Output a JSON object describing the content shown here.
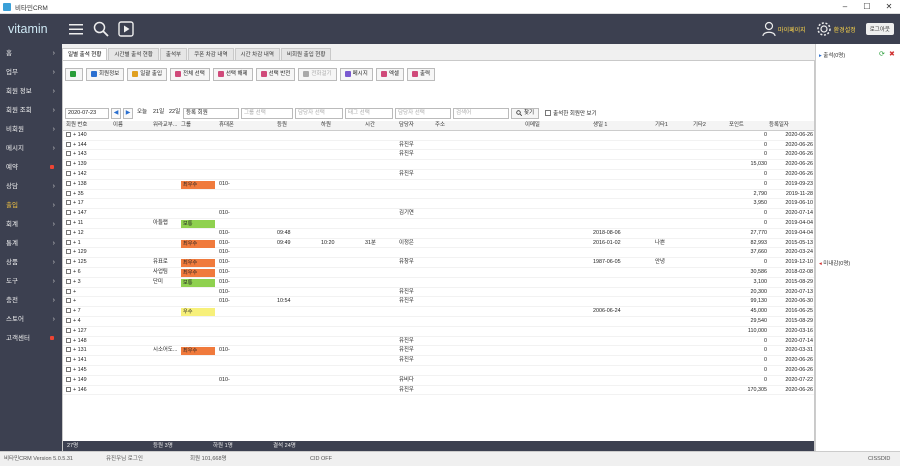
{
  "window": {
    "title": "비타민CRM",
    "min": "–",
    "max": "☐",
    "close": "✕"
  },
  "brand": "vitamin",
  "topbar": {
    "mypage": "마이페이지",
    "settings": "환경설정",
    "logout": "로그아웃"
  },
  "sidebar": [
    {
      "label": "홈",
      "suffix": "chevron"
    },
    {
      "label": "업무",
      "suffix": "chevron"
    },
    {
      "label": "회원 정보",
      "suffix": "chevron"
    },
    {
      "label": "회원 조회",
      "suffix": "chevron"
    },
    {
      "label": "비회원",
      "suffix": "chevron"
    },
    {
      "label": "메시지",
      "suffix": "chevron"
    },
    {
      "label": "예약",
      "suffix": "dot"
    },
    {
      "label": "상담",
      "suffix": "chevron"
    },
    {
      "label": "출입",
      "suffix": "chevron",
      "active": true
    },
    {
      "label": "회계",
      "suffix": "chevron"
    },
    {
      "label": "통계",
      "suffix": "chevron"
    },
    {
      "label": "상품",
      "suffix": "chevron"
    },
    {
      "label": "도구",
      "suffix": "chevron"
    },
    {
      "label": "충전",
      "suffix": "chevron"
    },
    {
      "label": "스토어",
      "suffix": "chevron"
    },
    {
      "label": "고객센터",
      "suffix": "dot"
    }
  ],
  "tabs": [
    "일별 출석 현황",
    "시간별 출석 현황",
    "출석부",
    "쿠폰 차감 내역",
    "시간 차감 내역",
    "비회원 출입 현황"
  ],
  "toolbar": [
    {
      "label": "",
      "icon": "refresh-icon",
      "color": "#2a9d3a"
    },
    {
      "label": "회원정보",
      "icon": "member-info-icon",
      "color": "#2a6fd0"
    },
    {
      "label": "일괄 출입",
      "icon": "bulk-entry-icon",
      "color": "#e0a020"
    },
    {
      "label": "전체 선택",
      "icon": "select-all-icon",
      "color": "#d04a7a"
    },
    {
      "label": "선택 해제",
      "icon": "deselect-icon",
      "color": "#d04a7a"
    },
    {
      "label": "선택 반전",
      "icon": "invert-select-icon",
      "color": "#d04a7a"
    },
    {
      "label": "전화걸기",
      "icon": "phone-icon",
      "color": "#aaa",
      "disabled": true
    },
    {
      "label": "메시지",
      "icon": "message-icon",
      "color": "#7a5ad0"
    },
    {
      "label": "엑셀",
      "icon": "excel-icon",
      "color": "#d04a7a"
    },
    {
      "label": "출력",
      "icon": "print-icon",
      "color": "#d04a7a"
    }
  ],
  "filters": {
    "date": "2020-07-23",
    "dayname": "오늘",
    "days": [
      "21일",
      "22일"
    ],
    "member_type": "등록 회원",
    "ph1": "그룹 선택",
    "ph2": "담당자 선택",
    "ph3": "태그 선택",
    "ph4": "담당자 선택",
    "ph5": "검색어",
    "search_label": "찾기",
    "checkbox_label": "출석한 회원만 보기"
  },
  "columns": [
    "회원 번호",
    "이름",
    "워라교부...",
    "그룹",
    "휴대폰",
    "등원",
    "하원",
    "시간",
    "담당자",
    "주소",
    "이메일",
    "생일 1",
    "기타1",
    "기타2",
    "포인트",
    "등록일자"
  ],
  "rows": [
    {
      "no": "140",
      "name": "",
      "work": "",
      "group": "",
      "phone": "",
      "in": "",
      "out": "",
      "time": "",
      "mgr": "",
      "addr": "",
      "email": "",
      "bday": "",
      "e1": "",
      "e2": "",
      "point": "0",
      "reg": "2020-06-26"
    },
    {
      "no": "144",
      "name": "",
      "work": "",
      "group": "",
      "phone": "",
      "in": "",
      "out": "",
      "time": "",
      "mgr": "유진우",
      "addr": "",
      "email": "",
      "bday": "",
      "e1": "",
      "e2": "",
      "point": "0",
      "reg": "2020-06-26"
    },
    {
      "no": "143",
      "name": "",
      "work": "",
      "group": "",
      "phone": "",
      "in": "",
      "out": "",
      "time": "",
      "mgr": "유진우",
      "addr": "",
      "email": "",
      "bday": "",
      "e1": "",
      "e2": "",
      "point": "0",
      "reg": "2020-06-26"
    },
    {
      "no": "139",
      "name": "",
      "work": "",
      "group": "",
      "phone": "",
      "in": "",
      "out": "",
      "time": "",
      "mgr": "",
      "addr": "",
      "email": "",
      "bday": "",
      "e1": "",
      "e2": "",
      "point": "15,030",
      "reg": "2020-06-26"
    },
    {
      "no": "142",
      "name": "",
      "work": "",
      "group": "",
      "phone": "",
      "in": "",
      "out": "",
      "time": "",
      "mgr": "유진우",
      "addr": "",
      "email": "",
      "bday": "",
      "e1": "",
      "e2": "",
      "point": "0",
      "reg": "2020-06-26"
    },
    {
      "no": "138",
      "name": "",
      "work": "",
      "group": "최우수",
      "phone": "010-",
      "in": "",
      "out": "",
      "time": "",
      "mgr": "",
      "addr": "",
      "email": "",
      "bday": "",
      "e1": "",
      "e2": "",
      "point": "0",
      "reg": "2019-09-23"
    },
    {
      "no": "35",
      "name": "",
      "work": "",
      "group": "",
      "phone": "",
      "in": "",
      "out": "",
      "time": "",
      "mgr": "",
      "addr": "",
      "email": "",
      "bday": "",
      "e1": "",
      "e2": "",
      "point": "2,790",
      "reg": "2019-11-28"
    },
    {
      "no": "17",
      "name": "",
      "work": "",
      "group": "",
      "phone": "",
      "in": "",
      "out": "",
      "time": "",
      "mgr": "",
      "addr": "",
      "email": "",
      "bday": "",
      "e1": "",
      "e2": "",
      "point": "3,950",
      "reg": "2019-06-10"
    },
    {
      "no": "147",
      "name": "",
      "work": "",
      "group": "",
      "phone": "010-",
      "in": "",
      "out": "",
      "time": "",
      "mgr": "김기연",
      "addr": "",
      "email": "",
      "bday": "",
      "e1": "",
      "e2": "",
      "point": "0",
      "reg": "2020-07-14"
    },
    {
      "no": "11",
      "name": "",
      "work": "아들랩",
      "group": "보통",
      "phone": "",
      "in": "",
      "out": "",
      "time": "",
      "mgr": "",
      "addr": "",
      "email": "",
      "bday": "",
      "e1": "",
      "e2": "",
      "point": "0",
      "reg": "2019-04-04"
    },
    {
      "no": "12",
      "name": "",
      "work": "",
      "group": "",
      "phone": "010-",
      "in": "09:48",
      "out": "",
      "time": "",
      "mgr": "",
      "addr": "",
      "email": "",
      "bday": "2018-08-06",
      "e1": "",
      "e2": "",
      "point": "27,770",
      "reg": "2019-04-04"
    },
    {
      "no": "1",
      "name": "",
      "work": "",
      "group": "최우수",
      "phone": "010-",
      "in": "09:49",
      "out": "10:20",
      "time": "31분",
      "mgr": "이정은",
      "addr": "",
      "email": "",
      "bday": "2016-01-02",
      "e1": "나쁜",
      "e2": "",
      "point": "82,993",
      "reg": "2015-05-13"
    },
    {
      "no": "129",
      "name": "",
      "work": "",
      "group": "",
      "phone": "010-",
      "in": "",
      "out": "",
      "time": "",
      "mgr": "",
      "addr": "",
      "email": "",
      "bday": "",
      "e1": "",
      "e2": "",
      "point": "37,660",
      "reg": "2020-03-24"
    },
    {
      "no": "125",
      "name": "",
      "work": "유표로",
      "group": "최우수",
      "phone": "010-",
      "in": "",
      "out": "",
      "time": "",
      "mgr": "유창우",
      "addr": "",
      "email": "",
      "bday": "1987-06-05",
      "e1": "안녕",
      "e2": "",
      "point": "0",
      "reg": "2019-12-10"
    },
    {
      "no": "6",
      "name": "",
      "work": "사업팀",
      "group": "최우수",
      "phone": "010-",
      "in": "",
      "out": "",
      "time": "",
      "mgr": "",
      "addr": "",
      "email": "",
      "bday": "",
      "e1": "",
      "e2": "",
      "point": "30,586",
      "reg": "2018-02-08"
    },
    {
      "no": "3",
      "name": "",
      "work": "단미",
      "group": "보통",
      "phone": "010-",
      "in": "",
      "out": "",
      "time": "",
      "mgr": "",
      "addr": "",
      "email": "",
      "bday": "",
      "e1": "",
      "e2": "",
      "point": "3,100",
      "reg": "2015-08-29"
    },
    {
      "no": "",
      "name": "",
      "work": "",
      "group": "",
      "phone": "010-",
      "in": "",
      "out": "",
      "time": "",
      "mgr": "유진우",
      "addr": "",
      "email": "",
      "bday": "",
      "e1": "",
      "e2": "",
      "point": "20,300",
      "reg": "2020-07-13"
    },
    {
      "no": "",
      "name": "",
      "work": "",
      "group": "",
      "phone": "010-",
      "in": "10:54",
      "out": "",
      "time": "",
      "mgr": "유진우",
      "addr": "",
      "email": "",
      "bday": "",
      "e1": "",
      "e2": "",
      "point": "99,130",
      "reg": "2020-06-30"
    },
    {
      "no": "7",
      "name": "",
      "work": "",
      "group": "우수",
      "phone": "",
      "in": "",
      "out": "",
      "time": "",
      "mgr": "",
      "addr": "",
      "email": "",
      "bday": "2006-06-24",
      "e1": "",
      "e2": "",
      "point": "45,000",
      "reg": "2016-06-25"
    },
    {
      "no": "4",
      "name": "",
      "work": "",
      "group": "",
      "phone": "",
      "in": "",
      "out": "",
      "time": "",
      "mgr": "",
      "addr": "",
      "email": "",
      "bday": "",
      "e1": "",
      "e2": "",
      "point": "29,540",
      "reg": "2015-08-29"
    },
    {
      "no": "127",
      "name": "",
      "work": "",
      "group": "",
      "phone": "",
      "in": "",
      "out": "",
      "time": "",
      "mgr": "",
      "addr": "",
      "email": "",
      "bday": "",
      "e1": "",
      "e2": "",
      "point": "110,000",
      "reg": "2020-03-16"
    },
    {
      "no": "148",
      "name": "",
      "work": "",
      "group": "",
      "phone": "",
      "in": "",
      "out": "",
      "time": "",
      "mgr": "유진우",
      "addr": "",
      "email": "",
      "bday": "",
      "e1": "",
      "e2": "",
      "point": "0",
      "reg": "2020-07-14"
    },
    {
      "no": "131",
      "name": "",
      "work": "시소어도...",
      "group": "최우수",
      "phone": "010-",
      "in": "",
      "out": "",
      "time": "",
      "mgr": "유진우",
      "addr": "",
      "email": "",
      "bday": "",
      "e1": "",
      "e2": "",
      "point": "0",
      "reg": "2020-03-31"
    },
    {
      "no": "141",
      "name": "",
      "work": "",
      "group": "",
      "phone": "",
      "in": "",
      "out": "",
      "time": "",
      "mgr": "유진우",
      "addr": "",
      "email": "",
      "bday": "",
      "e1": "",
      "e2": "",
      "point": "0",
      "reg": "2020-06-26"
    },
    {
      "no": "145",
      "name": "",
      "work": "",
      "group": "",
      "phone": "",
      "in": "",
      "out": "",
      "time": "",
      "mgr": "",
      "addr": "",
      "email": "",
      "bday": "",
      "e1": "",
      "e2": "",
      "point": "0",
      "reg": "2020-06-26"
    },
    {
      "no": "149",
      "name": "",
      "work": "",
      "group": "",
      "phone": "010-",
      "in": "",
      "out": "",
      "time": "",
      "mgr": "유비다",
      "addr": "",
      "email": "",
      "bday": "",
      "e1": "",
      "e2": "",
      "point": "0",
      "reg": "2020-07-22"
    },
    {
      "no": "146",
      "name": "",
      "work": "",
      "group": "",
      "phone": "",
      "in": "",
      "out": "",
      "time": "",
      "mgr": "유진우",
      "addr": "",
      "email": "",
      "bday": "",
      "e1": "",
      "e2": "",
      "point": "170,305",
      "reg": "2020-06-26"
    }
  ],
  "group_colors": {
    "최우수": "#f07a3c",
    "보통": "#8fd14f",
    "우수": "#f7f07a"
  },
  "summary": {
    "count": "27명",
    "in": "등원 3명",
    "out": "하원 1명",
    "absent": "결석 24명"
  },
  "right_panel": {
    "head1": "출석(0명)",
    "head2": "미내감(0명)"
  },
  "statusbar": {
    "version": "비타민CRM Version 5.0.5.31",
    "login": "유진우님 로그인",
    "members": "회원 101,668명",
    "cid": "CID OFF",
    "right": "CISSDID"
  }
}
